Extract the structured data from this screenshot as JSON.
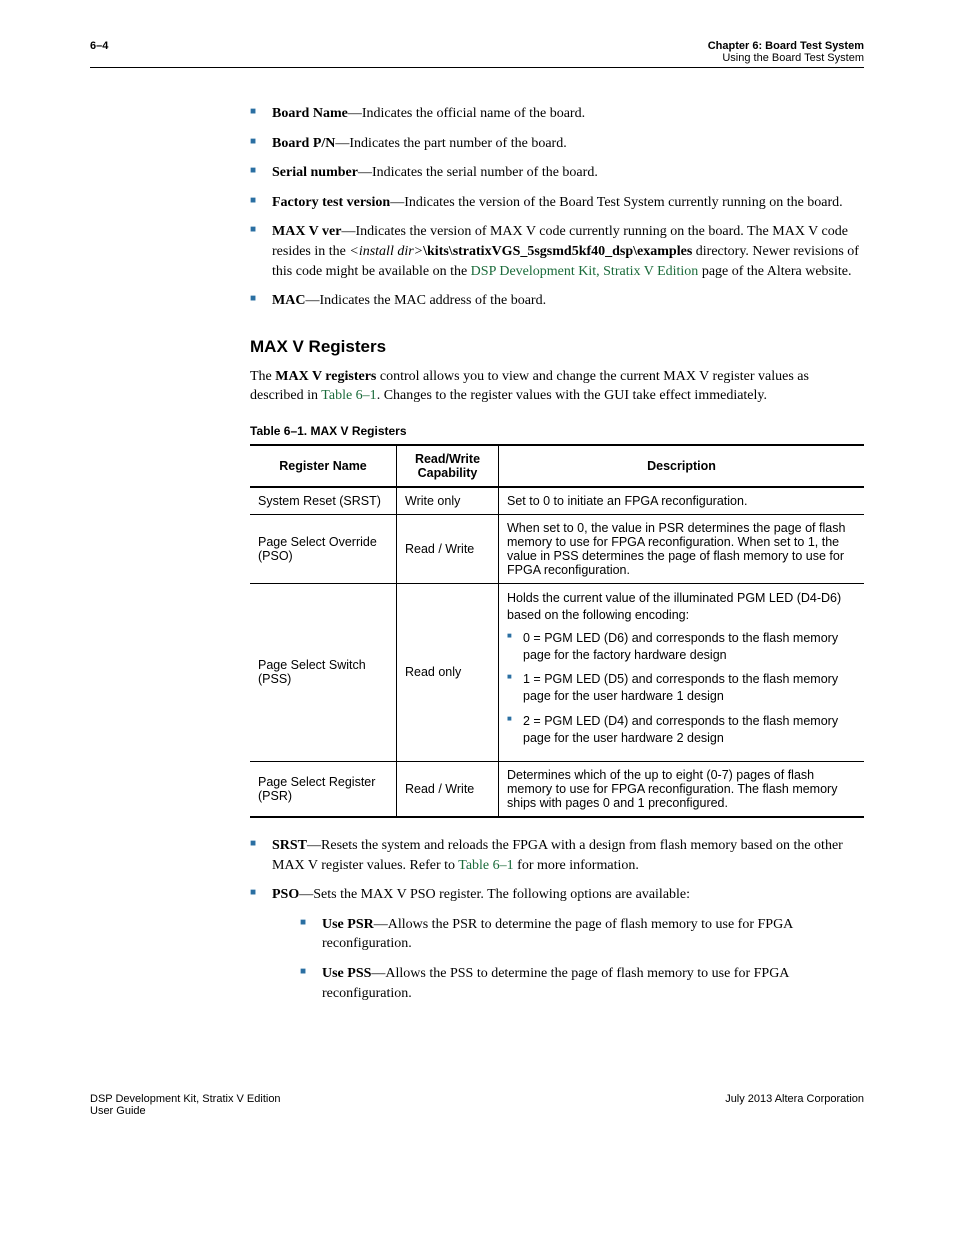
{
  "header": {
    "page_num": "6–4",
    "chapter": "Chapter 6:  Board Test System",
    "section": "Using the Board Test System"
  },
  "bullets_top": [
    {
      "bold": "Board Name",
      "rest": "—Indicates the official name of the board."
    },
    {
      "bold": "Board P/N",
      "rest": "—Indicates the part number of the board."
    },
    {
      "bold": "Serial number",
      "rest": "—Indicates the serial number of the board."
    },
    {
      "bold": "Factory test version",
      "rest": "—Indicates the version of the Board Test System currently running on the board."
    }
  ],
  "maxv": {
    "bold": "MAX V ver",
    "pre": "—Indicates the version of MAX V code currently running on the board. The MAX V code resides in the ",
    "install": "<install dir>",
    "path": "\\kits\\stratixVGS_5sgsmd5kf40_dsp\\examples",
    "mid": " directory. Newer revisions of this code might be available on the ",
    "link": "DSP Development Kit, Stratix V Edition",
    "post": " page of the Altera website."
  },
  "mac": {
    "bold": "MAC",
    "rest": "—Indicates the MAC address of the board."
  },
  "heading": "MAX V Registers",
  "intro": {
    "pre": "The ",
    "bold": "MAX V registers",
    "mid": " control allows you to view and change the current MAX V register values as described in ",
    "link": "Table 6–1",
    "post": ". Changes to the register values with the GUI take effect immediately."
  },
  "table": {
    "caption": "Table 6–1.  MAX V Registers",
    "headers": [
      "Register Name",
      "Read/Write Capability",
      "Description"
    ],
    "rows": [
      {
        "name": "System Reset (SRST)",
        "rw": "Write only",
        "desc_type": "text",
        "desc": "Set to 0 to initiate an FPGA reconfiguration."
      },
      {
        "name": "Page Select Override (PSO)",
        "rw": "Read / Write",
        "desc_type": "text",
        "desc": "When set to 0, the value in PSR determines the page of flash memory to use for FPGA reconfiguration. When set to 1, the value in PSS determines the page of flash memory to use for FPGA reconfiguration."
      },
      {
        "name": "Page Select Switch (PSS)",
        "rw": "Read only",
        "desc_type": "list",
        "intro": "Holds the current value of the illuminated PGM LED (D4-D6) based on the following encoding:",
        "items": [
          "0 = PGM LED (D6) and corresponds to the flash memory page for the factory hardware design",
          "1 = PGM LED (D5) and corresponds to the flash memory page for the user hardware 1 design",
          "2 = PGM LED (D4) and corresponds to the flash memory page for the user hardware 2 design"
        ]
      },
      {
        "name": "Page Select Register (PSR)",
        "rw": "Read / Write",
        "desc_type": "text",
        "desc": "Determines which of the up to eight (0-7) pages of flash memory to use for FPGA reconfiguration. The flash memory ships with pages 0 and 1 preconfigured."
      }
    ]
  },
  "srst": {
    "bold": "SRST",
    "pre": "—Resets the system and reloads the FPGA with a design from flash memory based on the other MAX V register values. Refer to ",
    "link": "Table 6–1",
    "post": " for more information."
  },
  "pso": {
    "bold": "PSO",
    "rest": "—Sets the MAX V PSO register. The following options are available:"
  },
  "pso_sub": [
    {
      "bold": "Use PSR",
      "rest": "—Allows the PSR to determine the page of flash memory to use for FPGA reconfiguration."
    },
    {
      "bold": "Use PSS",
      "rest": "—Allows the PSS to determine the page of flash memory to use for FPGA reconfiguration."
    }
  ],
  "footer": {
    "left1": "DSP Development Kit, Stratix V Edition",
    "left2": "User Guide",
    "right": "July 2013   Altera Corporation"
  }
}
